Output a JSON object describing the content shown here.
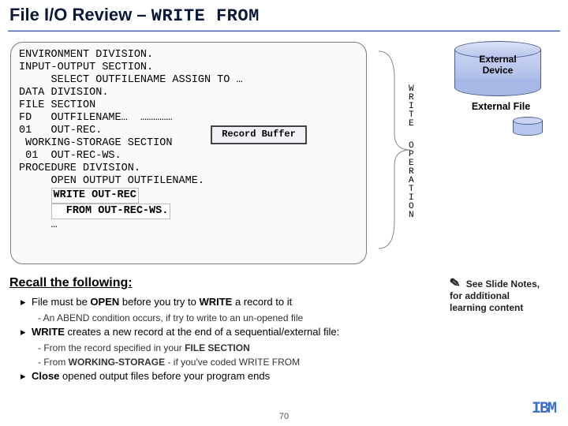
{
  "title": {
    "prefix": "File I/O Review – ",
    "mono": "WRITE FROM"
  },
  "code": {
    "l1": "ENVIRONMENT DIVISION.",
    "l2": "INPUT-OUTPUT SECTION.",
    "l3": "     SELECT OUTFILENAME ASSIGN TO …",
    "l4": "DATA DIVISION.",
    "l5": "FILE SECTION",
    "l6": "FD   OUTFILENAME…  ……………",
    "l7": "01   OUT-REC.",
    "l8": " WORKING-STORAGE SECTION",
    "l9": " 01  OUT-REC-WS.",
    "l10": "PROCEDURE DIVISION.",
    "l11": "     OPEN OUTPUT OUTFILENAME.",
    "h1": "WRITE OUT-REC",
    "h2": "  FROM OUT-REC-WS.",
    "l12": "     …"
  },
  "record_buffer": "Record Buffer",
  "vert": {
    "write": "W\nR\nI\nT\nE",
    "operation": "O\nP\nE\nR\nA\nT\nI\nO\nN"
  },
  "device": {
    "label": "External\nDevice",
    "file": "External File"
  },
  "recall": {
    "heading": "Recall the following:",
    "b1a": "File must be ",
    "b1b": "OPEN",
    "b1c": " before you try to ",
    "b1d": "WRITE",
    "b1e": "  a record to it",
    "b1sub": "- An ABEND condition occurs, if try to write to an un-opened file",
    "b2a": "WRITE",
    "b2b": " creates a new record at the end of a sequential/external file:",
    "b2sub1a": "- From the record specified in your ",
    "b2sub1b": "FILE SECTION",
    "b2sub2a": "- From ",
    "b2sub2b": "WORKING-STORAGE",
    "b2sub2c": " - if you've coded WRITE FROM",
    "b3a": "Close",
    "b3b": " opened output files before your program ends"
  },
  "note": {
    "icon": "✎",
    "l1": "  See Slide Notes,",
    "l2": "for additional",
    "l3": "learning content"
  },
  "page": "70",
  "logo": "IBM"
}
